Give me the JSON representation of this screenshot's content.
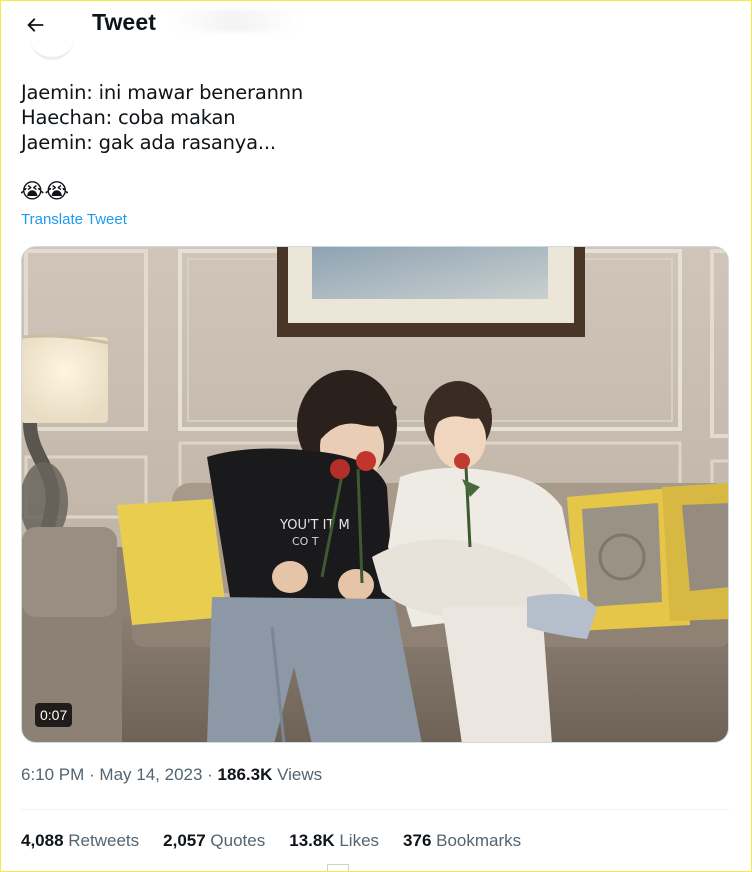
{
  "header": {
    "title": "Tweet",
    "back_icon": "arrow-left-icon"
  },
  "tweet": {
    "lines": [
      "Jaemin: ini mawar benerannn",
      "Haechan: coba makan",
      "Jaemin: gak ada rasanya..."
    ],
    "emojis": "😭😭",
    "translate_label": "Translate Tweet"
  },
  "media": {
    "type": "video",
    "duration": "0:07"
  },
  "meta": {
    "time": "6:10 PM",
    "separator": " · ",
    "date": "May 14, 2023",
    "views_count": "186.3K",
    "views_label": " Views"
  },
  "stats": [
    {
      "count": "4,088",
      "label": " Retweets"
    },
    {
      "count": "2,057",
      "label": " Quotes"
    },
    {
      "count": "13.8K",
      "label": " Likes"
    },
    {
      "count": "376",
      "label": " Bookmarks"
    }
  ],
  "colors": {
    "link": "#1d9bf0",
    "secondary_text": "#536471",
    "primary_text": "#0f1419"
  }
}
